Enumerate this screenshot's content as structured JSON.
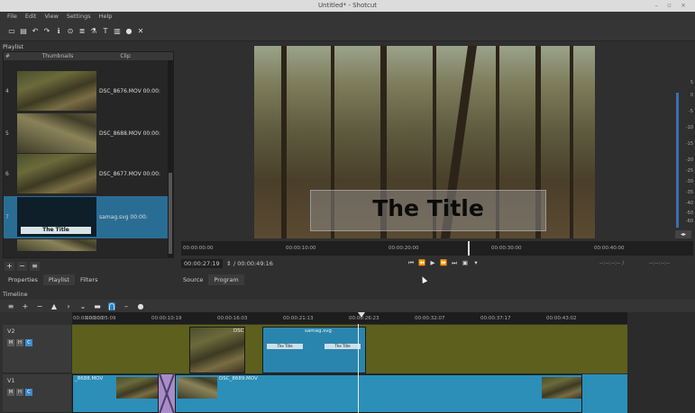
{
  "window": {
    "title": "Untitled* - Shotcut",
    "controls": "– ▫ ×"
  },
  "menu": [
    "File",
    "Edit",
    "View",
    "Settings",
    "Help"
  ],
  "toolbar_icons": [
    "open-icon",
    "save-icon",
    "undo-icon",
    "redo-icon",
    "properties-icon",
    "history-icon",
    "playlist-icon",
    "filters-icon",
    "text-icon",
    "keyframes-icon",
    "help-icon",
    "close-icon"
  ],
  "playlist": {
    "title": "Playlist",
    "headers": {
      "num": "#",
      "thumbnails": "Thumbnails",
      "clip": "Clip"
    },
    "rows": [
      {
        "num": "4",
        "clip": "DSC_8676.MOV 00:00:",
        "selected": false
      },
      {
        "num": "5",
        "clip": "DSC_8688.MOV 00:00:",
        "selected": false
      },
      {
        "num": "6",
        "clip": "DSC_8677.MOV 00:00:",
        "selected": false
      },
      {
        "num": "7",
        "clip": "samag.svg 00:00:",
        "selected": true,
        "thumb_label": "The Title"
      }
    ],
    "buttons": [
      "+",
      "−",
      "≡"
    ]
  },
  "left_tabs": [
    "Properties",
    "Playlist",
    "Filters"
  ],
  "viewer": {
    "overlay_text": "The Title"
  },
  "meter": {
    "labels": [
      "5",
      "0",
      "-5",
      "-10",
      "-15",
      "-20",
      "-25",
      "-30",
      "-35",
      "-40",
      "-50",
      "-60"
    ],
    "button": "◂▸"
  },
  "ruler": {
    "ticks": [
      "00:00:00:00",
      "00:00:10:00",
      "00:00:20:00",
      "00:00:30:00",
      "00:00:40:00"
    ]
  },
  "transport": {
    "position": "00:00:27:19",
    "duration": "/ 00:00:49:16",
    "buttons": [
      "⏮",
      "⏪",
      "▶",
      "⏩",
      "⏭",
      "▣",
      "▾"
    ],
    "in_point": "--:--:--:-- /",
    "out_point": "--:--:--:--"
  },
  "view_tabs": [
    "Source",
    "Program"
  ],
  "timeline": {
    "title": "Timeline",
    "toolbar": [
      "≡",
      "+",
      "−",
      "▲",
      "›",
      "⌄",
      "▬",
      "⋂",
      "–",
      "●"
    ],
    "ruler_ticks": [
      "00:00:00:00",
      "00:00:05:09",
      "00:00:10:19",
      "00:00:16:03",
      "00:00:21:13",
      "00:00:26:23",
      "00:00:32:07",
      "00:00:37:17",
      "00:00:43:02"
    ],
    "tracks": [
      {
        "name": "V2",
        "buttons": [
          "M",
          "H",
          "C"
        ]
      },
      {
        "name": "V1",
        "buttons": [
          "M",
          "H",
          "C"
        ]
      }
    ],
    "v2_clips": [
      "DSC",
      "samag.svg"
    ],
    "v2_title_chips": [
      "The Title",
      "The Title"
    ],
    "v1_clips": [
      "_8688.MOV",
      "DSC_8689.MOV"
    ]
  }
}
